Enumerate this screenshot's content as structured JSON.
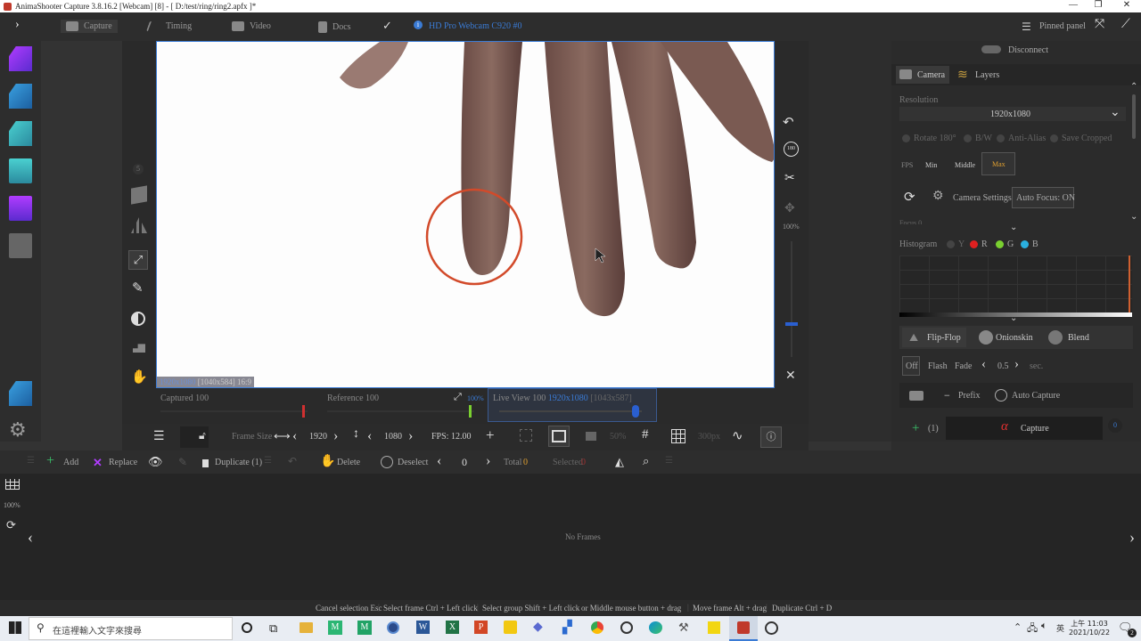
{
  "window": {
    "title": "AnimaShooter Capture 3.8.16.2 [Webcam] [8]  - [ D:/test/ring/ring2.apfx ]*",
    "min": "—",
    "max": "❐",
    "close": "✕"
  },
  "tabs": [
    "Capture",
    "Timing",
    "Video",
    "Docs"
  ],
  "camera_name": "HD Pro Webcam C920 #0",
  "pinned_panel": "Pinned panel",
  "left_number": "5",
  "viewport_info": {
    "res": "1920x1080",
    "size": "[1040x584]",
    "ratio": "16:9"
  },
  "right_zoom": "100%",
  "sliders": {
    "captured": "Captured 100",
    "reference": "Reference 100",
    "ref_zoom": "100%",
    "live_label": "Live View 100",
    "live_res": "1920x1080",
    "live_size": "[1043x587]"
  },
  "toolbar": {
    "frame_size": "Frame Size",
    "width": "1920",
    "height": "1080",
    "fps": "FPS: 12.00",
    "zoom_pct": "50%",
    "grid_px": "300px"
  },
  "framebar": {
    "add": "Add",
    "replace": "Replace",
    "duplicate": "Duplicate (1)",
    "delete": "Delete",
    "deselect": "Deselect",
    "index": "0",
    "total_label": "Total",
    "total_value": "0",
    "selected_label": "Selected",
    "selected_value": "0"
  },
  "timeline": {
    "zoom": "100%",
    "empty": "No Frames"
  },
  "panel": {
    "disconnect": "Disconnect",
    "tab_camera": "Camera",
    "tab_layers": "Layers",
    "resolution_label": "Resolution",
    "resolution_value": "1920x1080",
    "options": [
      "Rotate 180°",
      "B/W",
      "Anti-Alias",
      "Save Cropped"
    ],
    "fps_label": "FPS",
    "fps_min": "Min",
    "fps_middle": "Middle",
    "fps_max": "Max",
    "camera_settings": "Camera Settings",
    "auto_focus": "Auto Focus: ON",
    "focus": "Focus 0",
    "histogram": "Histogram",
    "hist_y": "Y",
    "hist_r": "R",
    "hist_g": "G",
    "hist_b": "B",
    "flipflop": "Flip-Flop",
    "onionskin": "Onionskin",
    "blend": "Blend",
    "off": "Off",
    "flash": "Flash",
    "fade": "Fade",
    "fade_value": "0.5",
    "fade_unit": "sec.",
    "prefix": "Prefix",
    "auto_capture": "Auto Capture",
    "count": "(1)",
    "capture": "Capture",
    "capture_count": "0"
  },
  "shortcuts": [
    "Cancel selection Esc",
    "Select frame Ctrl + Left click",
    "Select group Shift + Left click",
    "or Middle mouse button + drag",
    "Move frame Alt + drag",
    "Duplicate Ctrl + D"
  ],
  "taskbar": {
    "search_placeholder": "在這裡輸入文字來搜尋",
    "time": "上午 11:03",
    "date": "2021/10/22",
    "lang": "英",
    "notify_count": "2"
  },
  "colors": {
    "accent": "#3a7bd5",
    "capture_red": "#e03030",
    "max_orange": "#e0a030"
  }
}
